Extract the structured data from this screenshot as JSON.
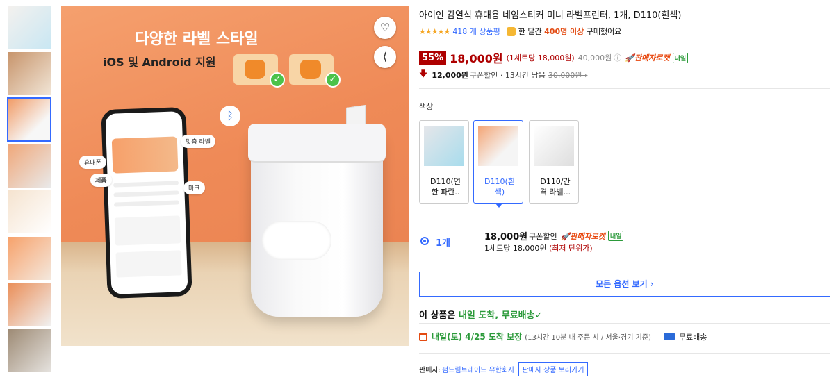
{
  "product": {
    "title": "아이인 감열식 휴대용 네임스티커 미니 라벨프린터, 1개, D110(흰색)",
    "stars": "★★★★★",
    "review_count": "418 개 상품평",
    "bought_prefix": "한 달간",
    "bought_count": "400명 이상",
    "bought_suffix": "구매했어요"
  },
  "pricing": {
    "discount": "55%",
    "sale_price": "18,000원",
    "unit_price": "(1세트당 18,000원)",
    "original_price": "40,000원",
    "rocket_label": "🚀판매자로켓",
    "naeil_badge": "내일",
    "coupon_amount": "12,000원",
    "coupon_meta": "쿠폰할인 · 13시간 남음",
    "coupon_original": "30,000원 ›"
  },
  "options": {
    "color_label": "색상",
    "items": [
      {
        "label": "D110(연\n한 파란..",
        "selected": false
      },
      {
        "label": "D110(흰\n색)",
        "selected": true
      },
      {
        "label": "D110/간\n격 라벨...",
        "selected": false
      }
    ],
    "qty_label": "1개",
    "opt_price": "18,000원",
    "opt_price_label": "쿠폰할인",
    "opt_rocket": "🚀판매자로켓",
    "opt_naeil": "내일",
    "opt_unit_text": "1세트당 18,000원",
    "opt_unit_low": "(최저 단위가)",
    "all_options_label": "모든 옵션 보기 ›"
  },
  "delivery": {
    "head_prefix": "이 상품은",
    "head_green": "내일 도착, 무료배송",
    "head_check": "✓",
    "date_text": "내일(토) 4/25 도착 보장",
    "date_note": "(13시간 10분 내 주문 시 / 서울·경기 기준)",
    "free_ship": "무료배송"
  },
  "seller": {
    "label": "판매자:",
    "name": "펌드림트레이드 유한회사",
    "button": "판매자 상품 보러가기"
  },
  "image_text": {
    "headline": "다양한 라벨 스타일",
    "subline": "iOS 및 Android 지원",
    "callout_product": "제품",
    "callout_phone": "휴대폰",
    "callout_mark": "마크",
    "callout_label": "맞춤 라벨"
  },
  "icons": {
    "heart": "♡",
    "share": "⟨",
    "check": "✓",
    "bluetooth": "ᛒ"
  },
  "colors": {
    "accent_blue": "#346aff",
    "sale_red": "#ae0000",
    "green": "#2b9a3a",
    "rocket_orange": "#e8460c"
  }
}
